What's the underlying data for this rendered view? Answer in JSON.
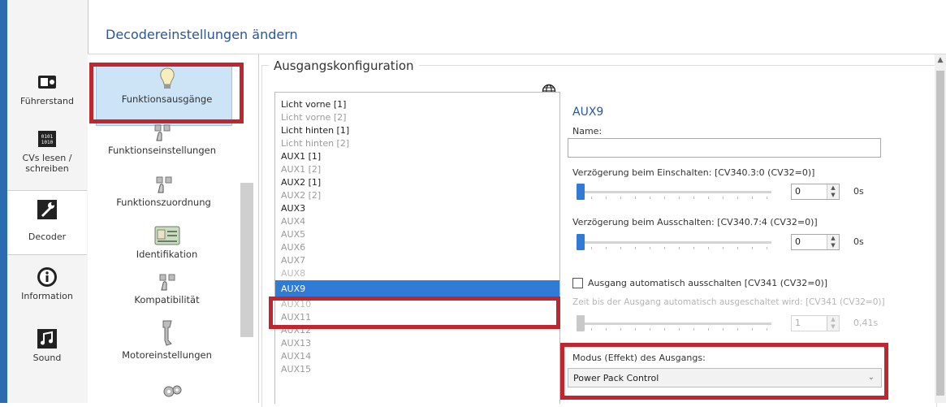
{
  "window": {
    "title": "Decodereinstellungen ändern"
  },
  "colors": {
    "accent": "#2f7bd6",
    "highlight_box": "#c0262f",
    "header_text": "#2b5797"
  },
  "leftbar": {
    "items": [
      {
        "label": "Führerstand",
        "icon": "driver-cab-icon"
      },
      {
        "label": "CVs lesen / schreiben",
        "icon": "cv-read-write-icon"
      },
      {
        "label": "Decoder",
        "icon": "wrench-icon",
        "active": true
      },
      {
        "label": "Information",
        "icon": "info-icon"
      },
      {
        "label": "Sound",
        "icon": "music-note-icon"
      }
    ]
  },
  "categories": [
    {
      "label": "Funktionsausgänge",
      "icon": "lightbulb-icon",
      "selected": true
    },
    {
      "label": "Funktionseinstellungen",
      "icon": "function-settings-icon"
    },
    {
      "label": "Funktionszuordnung",
      "icon": "function-mapping-icon"
    },
    {
      "label": "Identifikation",
      "icon": "id-card-icon"
    },
    {
      "label": "Kompatibilität",
      "icon": "compatibility-icon"
    },
    {
      "label": "Motoreinstellungen",
      "icon": "motor-icon"
    }
  ],
  "group": {
    "title": "Ausgangskonfiguration",
    "globe_icon": "globe-icon"
  },
  "outputs": [
    "Licht vorne [1]",
    "Licht vorne [2]",
    "Licht hinten [1]",
    "Licht hinten [2]",
    "AUX1 [1]",
    "AUX1 [2]",
    "AUX2 [1]",
    "AUX2 [2]",
    "AUX3",
    "AUX4",
    "AUX5",
    "AUX6",
    "AUX7",
    "AUX8",
    "AUX9",
    "AUX10",
    "AUX11",
    "AUX12",
    "AUX13",
    "AUX14",
    "AUX15"
  ],
  "selected_output": "AUX9",
  "detail": {
    "title": "AUX9",
    "name_label": "Name:",
    "name_value": "",
    "on_delay_label": "Verzögerung beim Einschalten: [CV340.3:0 (CV32=0)]",
    "on_delay_value": "0",
    "on_delay_unit": "0s",
    "on_delay_fraction": 0,
    "off_delay_label": "Verzögerung beim Ausschalten: [CV340.7:4 (CV32=0)]",
    "off_delay_value": "0",
    "off_delay_unit": "0s",
    "off_delay_fraction": 0,
    "auto_off_label": "Ausgang automatisch ausschalten [CV341 (CV32=0)]",
    "auto_off_checked": false,
    "auto_off_time_label": "Zeit bis der Ausgang automatisch ausgeschaltet wird: [CV341 (CV32=0)]",
    "auto_off_time_value": "1",
    "auto_off_time_unit": "0,41s",
    "mode_label": "Modus (Effekt) des Ausgangs:",
    "mode_value": "Power Pack Control"
  }
}
